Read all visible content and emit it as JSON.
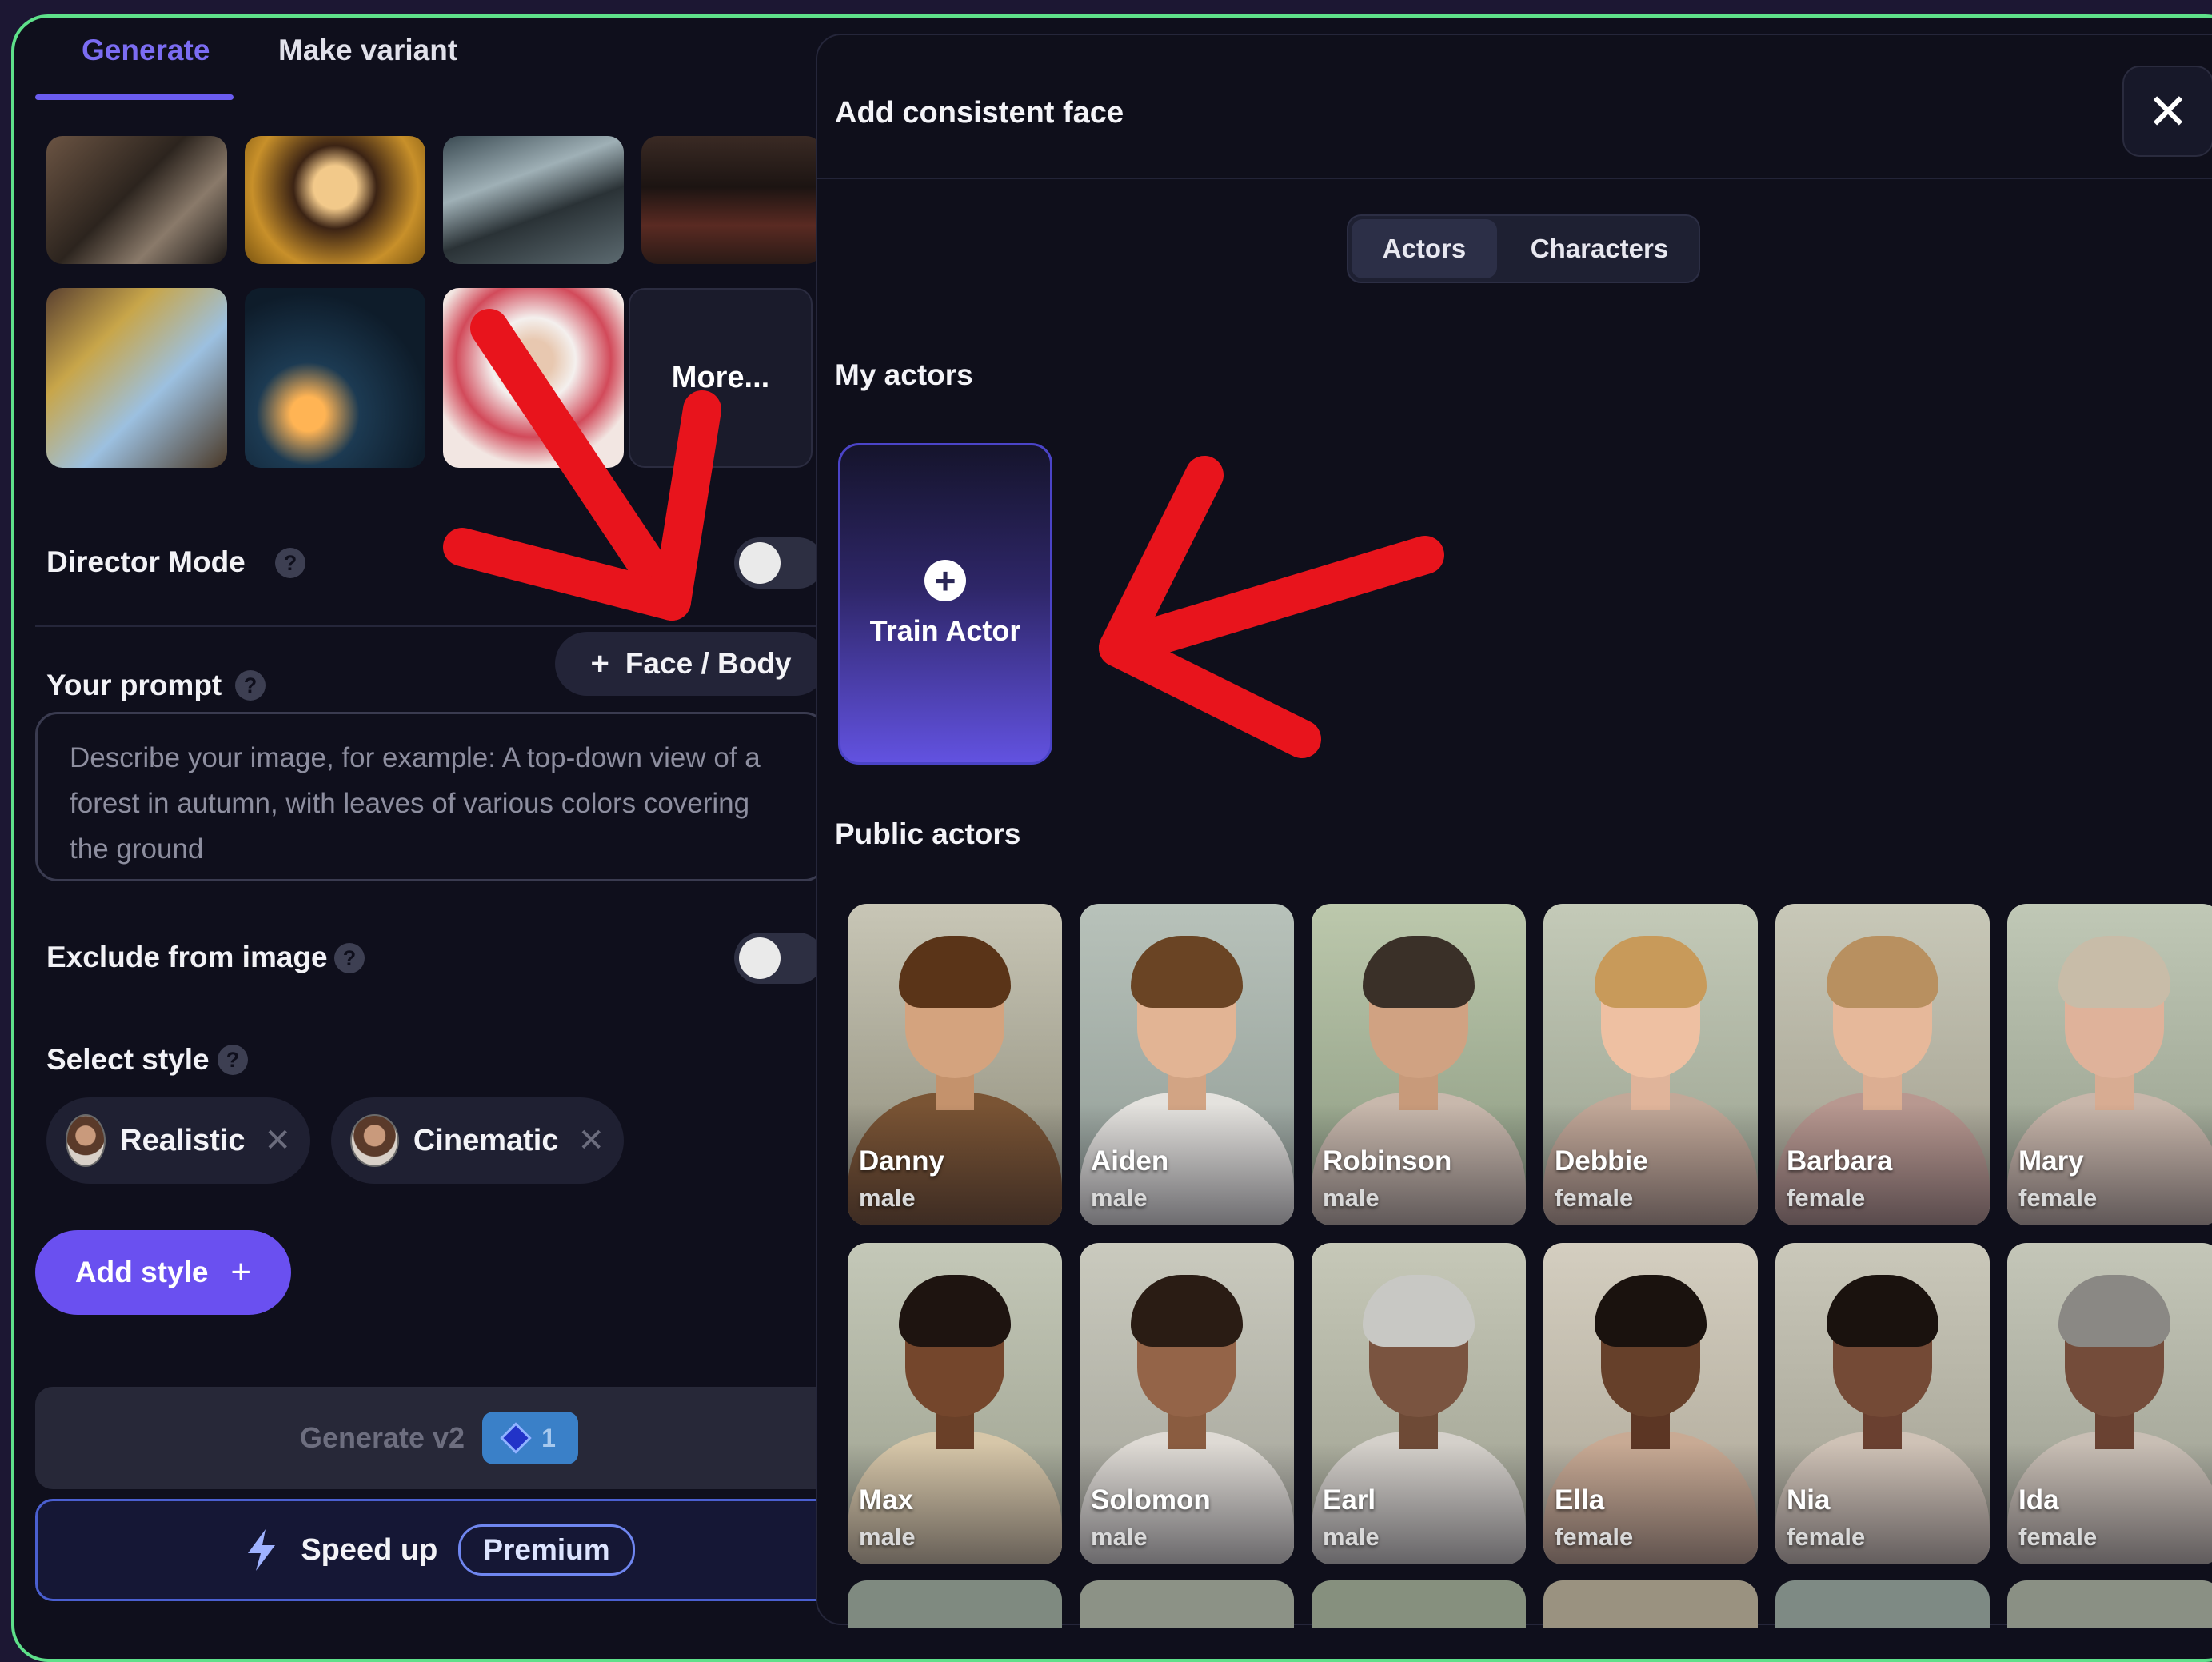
{
  "tabs": {
    "generate": "Generate",
    "make_variant": "Make variant"
  },
  "left": {
    "more_label": "More...",
    "director_mode": "Director Mode",
    "your_prompt": "Your prompt",
    "face_body_button": "Face / Body",
    "prompt_placeholder": "Describe your image, for example: A top-down view of a forest in autumn, with leaves of various colors covering the ground",
    "exclude_from_image": "Exclude from image",
    "select_style": "Select style",
    "styles": [
      {
        "label": "Realistic"
      },
      {
        "label": "Cinematic"
      }
    ],
    "add_style": "Add style",
    "generate_button": "Generate v2",
    "generate_cost": "1",
    "speed_up": "Speed up",
    "premium": "Premium"
  },
  "modal": {
    "title": "Add consistent face",
    "segment_actors": "Actors",
    "segment_characters": "Characters",
    "my_actors": "My actors",
    "train_actor": "Train Actor",
    "public_actors": "Public actors",
    "actors": [
      {
        "name": "Danny",
        "gender": "male"
      },
      {
        "name": "Aiden",
        "gender": "male"
      },
      {
        "name": "Robinson",
        "gender": "male"
      },
      {
        "name": "Debbie",
        "gender": "female"
      },
      {
        "name": "Barbara",
        "gender": "female"
      },
      {
        "name": "Mary",
        "gender": "female"
      },
      {
        "name": "Max",
        "gender": "male"
      },
      {
        "name": "Solomon",
        "gender": "male"
      },
      {
        "name": "Earl",
        "gender": "male"
      },
      {
        "name": "Ella",
        "gender": "female"
      },
      {
        "name": "Nia",
        "gender": "female"
      },
      {
        "name": "Ida",
        "gender": "female"
      }
    ]
  },
  "colors": {
    "accent": "#6a50f0",
    "frame_border": "#5ee08a",
    "annotation_arrow": "#e8141c"
  }
}
